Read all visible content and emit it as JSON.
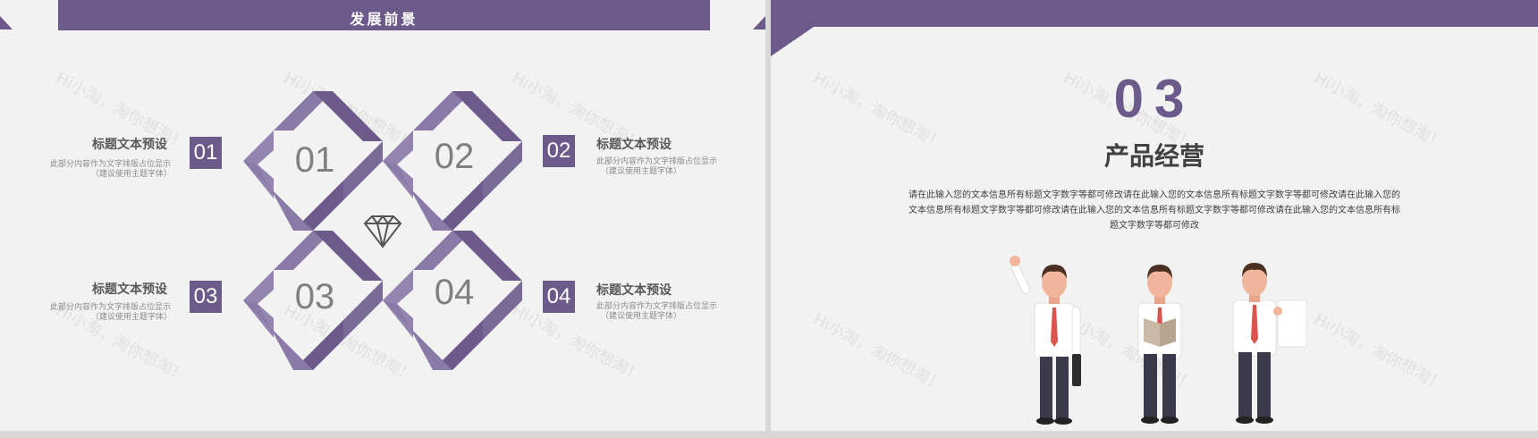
{
  "left_slide": {
    "header_title": "发展前景",
    "items": [
      {
        "num": "01",
        "title": "标题文本预设",
        "desc1": "此部分内容作为文字排版占位显示",
        "desc2": "（建议使用主题字体）"
      },
      {
        "num": "02",
        "title": "标题文本预设",
        "desc1": "此部分内容作为文字排版占位显示",
        "desc2": "（建议使用主题字体）"
      },
      {
        "num": "03",
        "title": "标题文本预设",
        "desc1": "此部分内容作为文字排版占位显示",
        "desc2": "（建议使用主题字体）"
      },
      {
        "num": "04",
        "title": "标题文本预设",
        "desc1": "此部分内容作为文字排版占位显示",
        "desc2": "（建议使用主题字体）"
      }
    ],
    "center_icon": "diamond-icon"
  },
  "right_slide": {
    "section_number": "03",
    "section_title": "产品经营",
    "body_line1": "请在此输入您的文本信息所有标题文字数字等都可修改请在此输入您的文本信息所有标题文字数字等都可修改请在此输入您的",
    "body_line2": "文本信息所有标题文字数字等都可修改请在此输入您的文本信息所有标题文字数字等都可修改请在此输入您的文本信息所有标",
    "body_line3": "题文字数字等都可修改",
    "figures": [
      "businessman-waving",
      "businessman-reading",
      "businessman-holding-board"
    ]
  },
  "watermark": "Hi小淘，淘你想淘！",
  "colors": {
    "accent": "#6b5a8a",
    "accent_light": "#8a7aa8",
    "background": "#f2f2f2"
  }
}
